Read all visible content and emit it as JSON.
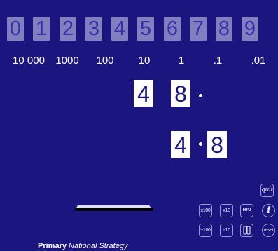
{
  "digit_tiles": [
    "0",
    "1",
    "2",
    "3",
    "4",
    "5",
    "6",
    "7",
    "8",
    "9"
  ],
  "place_values": [
    "10 000",
    "1000",
    "100",
    "10",
    "1",
    ".1",
    ".01"
  ],
  "cards_top": {
    "tens": "4",
    "ones": "8"
  },
  "cards_bottom": {
    "ones": "4",
    "tenths": "8"
  },
  "controls": {
    "quit": "quit",
    "info": "i",
    "times100": "x100",
    "times10": "x10",
    "htu": "HTU",
    "divide100": "÷100",
    "divide10": "÷10",
    "reset": "reset"
  },
  "footer": {
    "brand_bold": "Primary",
    "brand_italic": "National Strategy"
  },
  "colors": {
    "background": "#1b1580",
    "digit_tile": "#8080c0",
    "digit_text": "#3a2fa8",
    "card": "#ffffff",
    "shelf": "#000000"
  }
}
